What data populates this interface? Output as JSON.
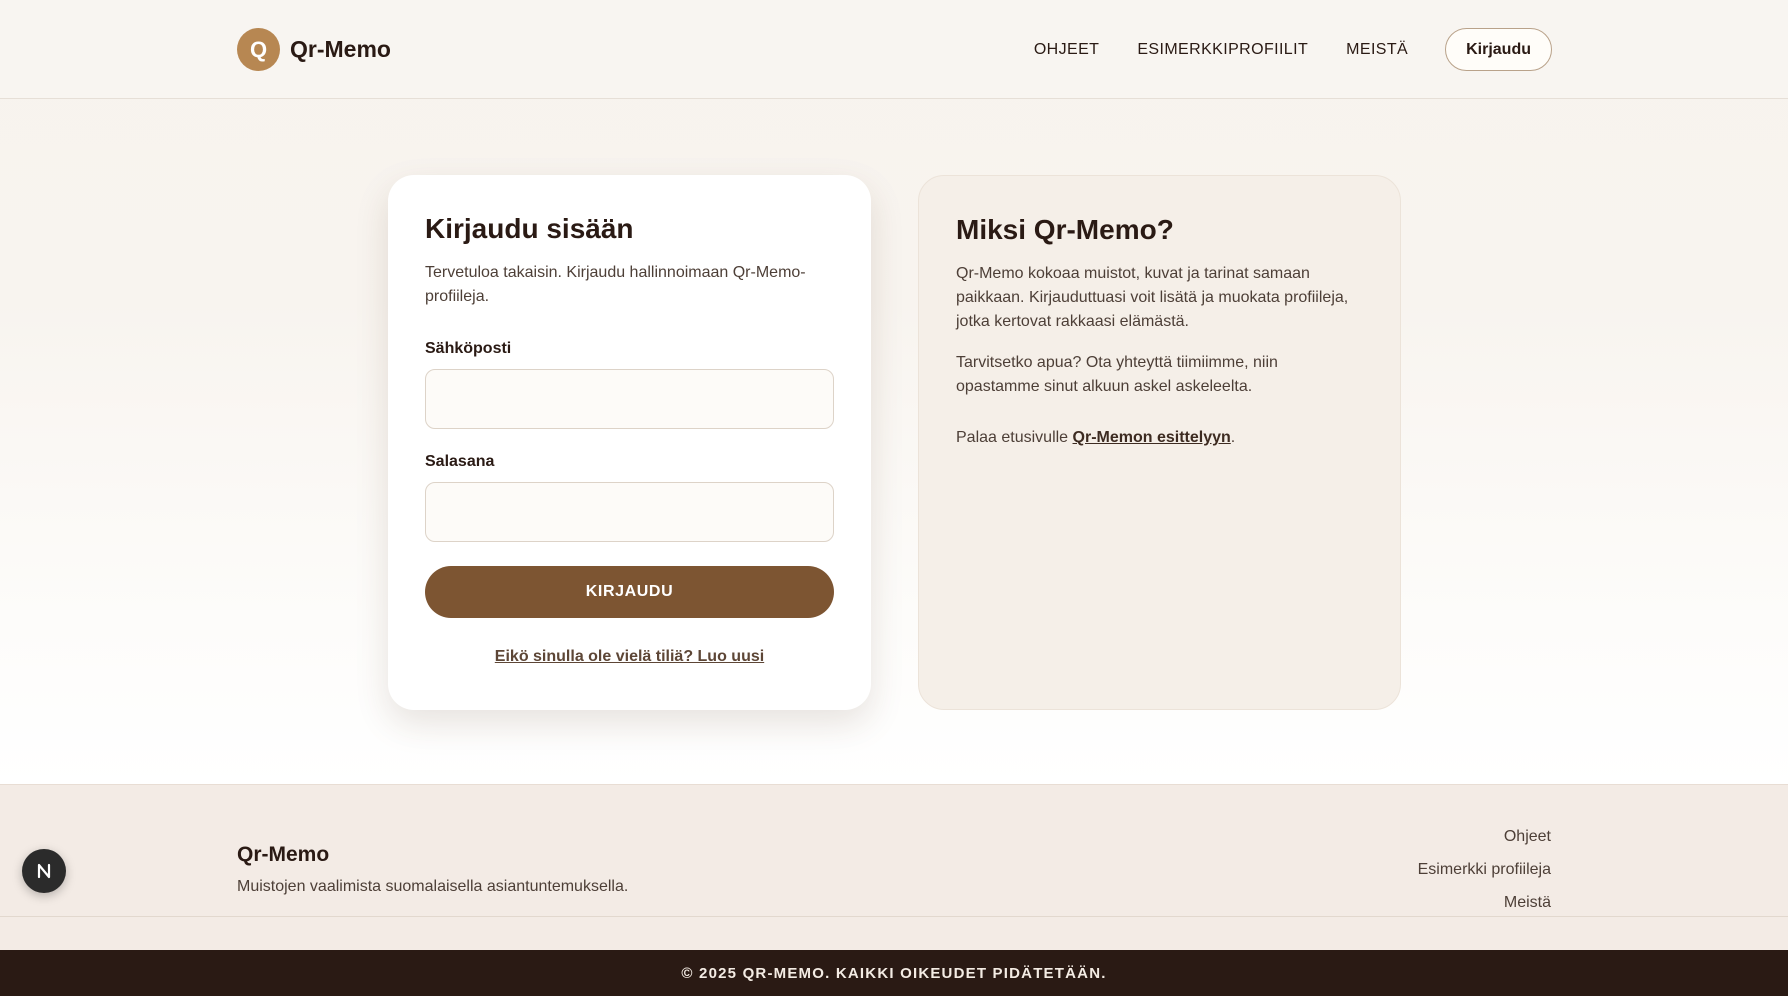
{
  "header": {
    "logo_letter": "Q",
    "logo_text": "Qr-Memo",
    "nav": [
      "OHJEET",
      "ESIMERKKIPROFIILIT",
      "MEISTÄ"
    ],
    "login_button": "Kirjaudu"
  },
  "login_card": {
    "title": "Kirjaudu sisään",
    "intro": "Tervetuloa takaisin. Kirjaudu hallinnoimaan Qr-Memo-profiileja.",
    "email_label": "Sähköposti",
    "email_value": "",
    "password_label": "Salasana",
    "password_value": "",
    "submit_label": "KIRJAUDU",
    "register_link": "Eikö sinulla ole vielä tiliä? Luo uusi"
  },
  "why_card": {
    "title": "Miksi Qr-Memo?",
    "paragraph1": "Qr-Memo kokoaa muistot, kuvat ja tarinat samaan paikkaan. Kirjauduttuasi voit lisätä ja muokata profiileja, jotka kertovat rakkaasi elämästä.",
    "paragraph2": "Tarvitsetko apua? Ota yhteyttä tiimiimme, niin opastamme sinut alkuun askel askeleelta.",
    "back_prefix": "Palaa etusivulle ",
    "back_link": "Qr-Memon esittelyyn",
    "back_suffix": "."
  },
  "footer": {
    "brand": "Qr-Memo",
    "tagline": "Muistojen vaalimista suomalaisella asiantuntemuksella.",
    "links": [
      "Ohjeet",
      "Esimerkki profiileja",
      "Meistä"
    ],
    "copyright": "© 2025 QR-MEMO. KAIKKI OIKEUDET PIDÄTETÄÄN."
  },
  "dev_badge": {
    "icon": "nextjs-icon"
  },
  "colors": {
    "accent": "#7d5532",
    "logo_badge": "#b78752",
    "dark": "#2a1a14",
    "footer_bg": "#f3ebe5"
  }
}
